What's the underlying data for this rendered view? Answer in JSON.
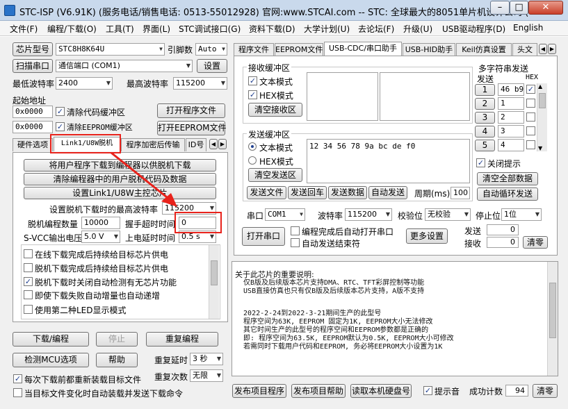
{
  "title": "STC-ISP (V6.91K) (服务电话/销售电话: 0513-55012928) 官网:www.STCAI.com  -- STC: 全球最大的8051单片机设计公司 (",
  "menu": [
    "文件(F)",
    "编程/下载(O)",
    "工具(T)",
    "界面(L)",
    "STC调试接口(G)",
    "资料下载(D)",
    "大学计划(U)",
    "去论坛(F)",
    "升级(U)",
    "USB驱动程序(D)",
    "English"
  ],
  "left": {
    "chip_label": "芯片型号",
    "chip_value": "STC8H8K64U",
    "pin_label": "引脚数",
    "pin_value": "Auto",
    "scan_label": "扫描串口",
    "port_value": "通信端口 (COM1)",
    "settings": "设置",
    "min_baud_label": "最低波特率",
    "min_baud": "2400",
    "max_baud_label": "最高波特率",
    "max_baud": "115200",
    "start_addr_label": "起始地址",
    "addr1": "0x0000",
    "clear_code": "清除代码缓冲区",
    "open_prog": "打开程序文件",
    "addr2": "0x0000",
    "clear_eeprom": "清除EEPROM缓冲区",
    "open_eeprom": "打开EEPROM文件",
    "tabs": [
      "硬件选项",
      "Link1/U8W脱机",
      "程序加密后传输",
      "ID号"
    ],
    "btn_download_prog": "将用户程序下载到编程器以供脱机下载",
    "btn_clear_prog": "清除编程器中的用户脱机代码及数据",
    "btn_set_link": "设置Link1/U8W主控芯片",
    "max_baud_offline_label": "设置脱机下载时的最高波特率",
    "max_baud_offline": "115200",
    "offline_count_label": "脱机编程数量",
    "offline_count": "10000",
    "handshake_label": "握手超时时间",
    "handshake": "0",
    "svcc_label": "S-VCC输出电压",
    "svcc": "5.0 V",
    "power_delay_label": "上电延时时间",
    "power_delay": "0.5 s",
    "options": [
      {
        "label": "在线下载完成后持续给目标芯片供电",
        "checked": false
      },
      {
        "label": "脱机下载完成后持续给目标芯片供电",
        "checked": false
      },
      {
        "label": "脱机下载时关闭自动检测有无芯片功能",
        "checked": true
      },
      {
        "label": "即使下载失败自动增量也自动递增",
        "checked": false
      },
      {
        "label": "使用第二种LED显示模式",
        "checked": false
      }
    ],
    "btn_download": "下载/编程",
    "btn_stop": "停止",
    "btn_repeat": "重复编程",
    "btn_detect": "检测MCU选项",
    "btn_help": "帮助",
    "repeat_delay_label": "重复延时",
    "repeat_delay": "3 秒",
    "repeat_count_label": "重复次数",
    "repeat_count": "无限",
    "reload_label": "每次下载前都重新装载目标文件",
    "auto_label": "当目标文件变化时自动装载并发送下载命令"
  },
  "right": {
    "tabs": [
      "程序文件",
      "EEPROM文件",
      "USB-CDC/串口助手",
      "USB-HID助手",
      "Keil仿真设置",
      "头文"
    ],
    "recv_group": "接收缓冲区",
    "text_mode": "文本模式",
    "hex_mode": "HEX模式",
    "clear_recv": "清空接收区",
    "send_group": "发送缓冲区",
    "send_text_mode": "文本模式",
    "send_hex_mode": "HEX模式",
    "clear_send": "清空发送区",
    "send_data": "12 34 56 78 9a bc de f0",
    "btn_send_file": "发送文件",
    "btn_send_enter": "发送回车",
    "btn_send_data": "发送数据",
    "btn_auto_send": "自动发送",
    "period_label": "周期(ms)",
    "period": "100",
    "multi_title": "多字符串发送",
    "send_col": "发送",
    "hex_col": "HEX",
    "multi": [
      {
        "n": "1",
        "v": "46 b9",
        "hex": true
      },
      {
        "n": "2",
        "v": "1",
        "hex": false
      },
      {
        "n": "3",
        "v": "2",
        "hex": false
      },
      {
        "n": "4",
        "v": "3",
        "hex": false
      },
      {
        "n": "5",
        "v": "4",
        "hex": false
      }
    ],
    "close_hint": "关闭提示",
    "clear_all": "清空全部数据",
    "auto_loop": "自动循环发送",
    "port_label": "串口",
    "port": "COM1",
    "baud_label": "波特率",
    "baud": "115200",
    "parity_label": "校验位",
    "parity": "无校验",
    "stop_label": "停止位",
    "stop": "1位",
    "open_port": "打开串口",
    "opt1": "编程完成后自动打开串口",
    "opt2": "自动发送结束符",
    "more_settings": "更多设置",
    "send_lbl": "发送",
    "send_count": "0",
    "recv_lbl": "接收",
    "recv_count": "0",
    "clear": "清零",
    "info": [
      "关于此芯片的重要说明:",
      "  仅B版及后续版本芯片支持DMA、RTC、TFT彩屏控制等功能",
      "  USB直接仿真也只有仅B版及后续版本芯片支持，A版不支持",
      "",
      "  2022-2-24到2022-3-21期间生产的此型号",
      "  程序空间为63K, EEPROM 固定为1K, EEPROM大小无法修改",
      "  其它时间生产的此型号的程序空间和EEPROM参数都是正确的",
      "  即: 程序空间为63.5K, EEPROM默认为0.5K, EEPROM大小可修改",
      "  若需同时下载用户代码和EEPROM, 务必将EEPROM大小设置为1K"
    ],
    "btn_publish": "发布项目程序",
    "btn_publish_help": "发布项目帮助",
    "btn_read_disk": "读取本机硬盘号",
    "sound_label": "提示音",
    "success_label": "成功计数",
    "success_count": "94",
    "clear2": "清零"
  }
}
